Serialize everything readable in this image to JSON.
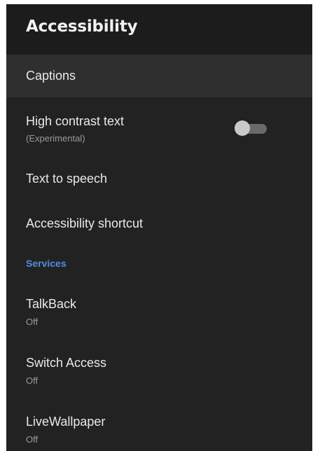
{
  "header": {
    "title": "Accessibility"
  },
  "items": [
    {
      "title": "Captions"
    },
    {
      "title": "High contrast text",
      "subtitle": "(Experimental)",
      "toggle_on": false
    },
    {
      "title": "Text to speech"
    },
    {
      "title": "Accessibility shortcut"
    }
  ],
  "services": {
    "header": "Services",
    "items": [
      {
        "title": "TalkBack",
        "subtitle": "Off"
      },
      {
        "title": "Switch Access",
        "subtitle": "Off"
      },
      {
        "title": "LiveWallpaper",
        "subtitle": "Off"
      }
    ]
  },
  "colors": {
    "background": "#222223",
    "header_background": "#1c1c1d",
    "selected_row": "#2f2f30",
    "accent": "#4f8fe2",
    "primary_text": "#e9e9e9",
    "secondary_text": "#9a9a9a"
  }
}
